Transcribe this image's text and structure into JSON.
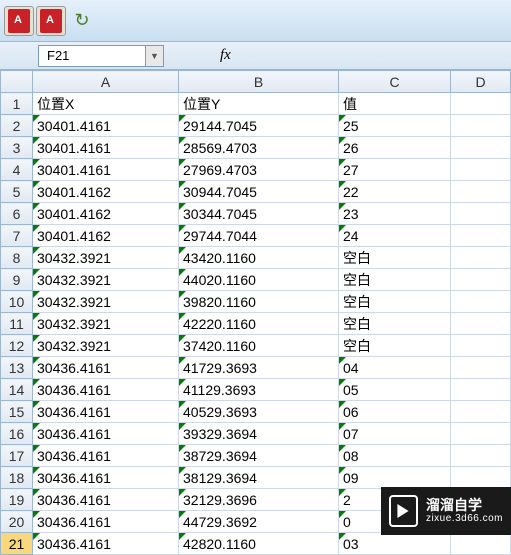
{
  "toolbar": {
    "refresh_glyph": "↻"
  },
  "namebox": {
    "cell_ref": "F21",
    "fx_label": "fx"
  },
  "columns": [
    "A",
    "B",
    "C",
    "D"
  ],
  "rowheads": [
    "1",
    "2",
    "3",
    "4",
    "5",
    "6",
    "7",
    "8",
    "9",
    "10",
    "11",
    "12",
    "13",
    "14",
    "15",
    "16",
    "17",
    "18",
    "19",
    "20",
    "21"
  ],
  "active_row": "21",
  "headers": {
    "a": "位置X",
    "b": "位置Y",
    "c": "值"
  },
  "rows": [
    {
      "a": "30401.4161",
      "b": "29144.7045",
      "c": "25"
    },
    {
      "a": "30401.4161",
      "b": "28569.4703",
      "c": "26"
    },
    {
      "a": "30401.4161",
      "b": "27969.4703",
      "c": "27"
    },
    {
      "a": "30401.4162",
      "b": "30944.7045",
      "c": "22"
    },
    {
      "a": "30401.4162",
      "b": "30344.7045",
      "c": "23"
    },
    {
      "a": "30401.4162",
      "b": "29744.7044",
      "c": "24"
    },
    {
      "a": "30432.3921",
      "b": "43420.1160",
      "c": "空白"
    },
    {
      "a": "30432.3921",
      "b": "44020.1160",
      "c": "空白"
    },
    {
      "a": "30432.3921",
      "b": "39820.1160",
      "c": "空白"
    },
    {
      "a": "30432.3921",
      "b": "42220.1160",
      "c": "空白"
    },
    {
      "a": "30432.3921",
      "b": "37420.1160",
      "c": "空白"
    },
    {
      "a": "30436.4161",
      "b": "41729.3693",
      "c": "04"
    },
    {
      "a": "30436.4161",
      "b": "41129.3693",
      "c": "05"
    },
    {
      "a": "30436.4161",
      "b": "40529.3693",
      "c": "06"
    },
    {
      "a": "30436.4161",
      "b": "39329.3694",
      "c": "07"
    },
    {
      "a": "30436.4161",
      "b": "38729.3694",
      "c": "08"
    },
    {
      "a": "30436.4161",
      "b": "38129.3694",
      "c": "09"
    },
    {
      "a": "30436.4161",
      "b": "32129.3696",
      "c": "2"
    },
    {
      "a": "30436.4161",
      "b": "44729.3692",
      "c": "0"
    },
    {
      "a": "30436.4161",
      "b": "42820.1160",
      "c": "03"
    }
  ],
  "watermark": {
    "main": "溜溜自学",
    "sub": "zixue.3d66.com"
  }
}
